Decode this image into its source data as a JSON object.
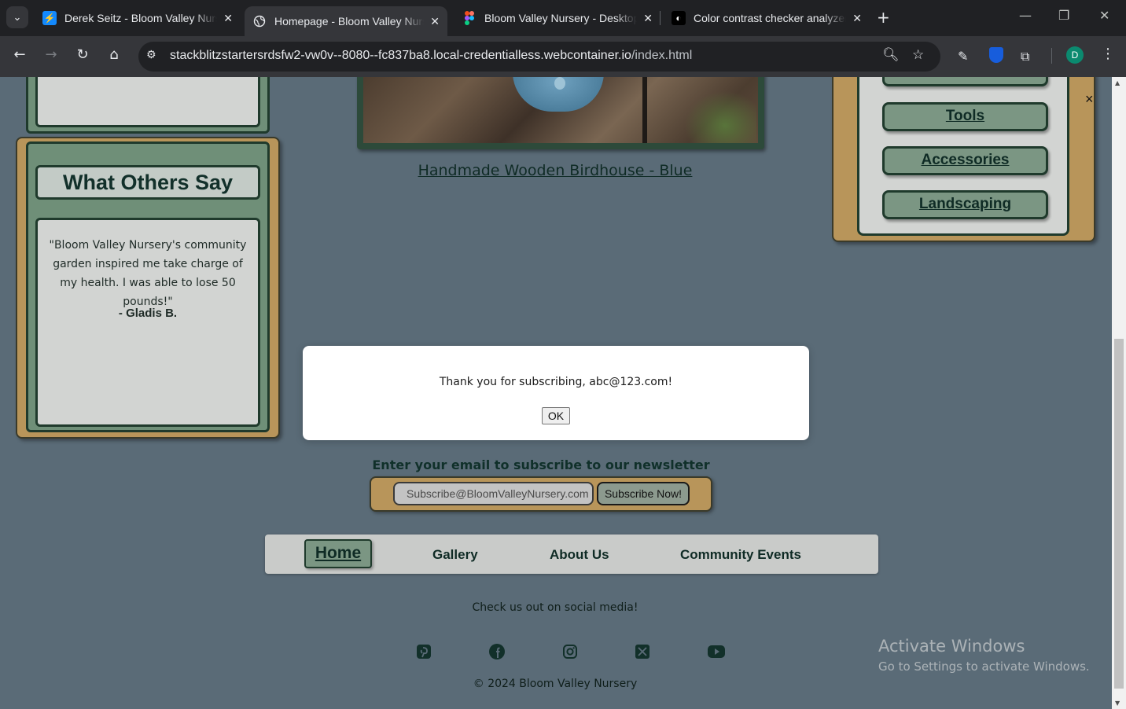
{
  "browser": {
    "tabs": [
      {
        "title": "Derek Seitz - Bloom Valley Nursery",
        "active": false,
        "favicon": "stackblitz-icon"
      },
      {
        "title": "Homepage - Bloom Valley Nursery",
        "active": true,
        "favicon": "globe-icon"
      },
      {
        "title": "Bloom Valley Nursery - Desktop",
        "active": false,
        "favicon": "figma-icon"
      },
      {
        "title": "Color contrast checker analyzer",
        "active": false,
        "favicon": "contrast-icon"
      }
    ],
    "url_host": "stackblitzstartersrdsfw2-vw0v--8080--fc837ba8.local-credentialless.webcontainer.io",
    "url_path": "/index.html",
    "profile_initial": "D"
  },
  "testimonials": {
    "heading": "What Others Say",
    "quote": "\"Bloom Valley Nursery's community garden inspired me take charge of my health. I was able to lose 50 pounds!\"",
    "author": "- Gladis B."
  },
  "product": {
    "link_text": "Handmade Wooden Birdhouse - Blue"
  },
  "categories": {
    "items": [
      "Tools",
      "Accessories",
      "Landscaping"
    ],
    "close_label": "×"
  },
  "dialog": {
    "message": "Thank you for subscribing, abc@123.com!",
    "ok_label": "OK"
  },
  "newsletter": {
    "label": "Enter your email to subscribe to our newsletter",
    "placeholder": "Subscribe@BloomValleyNursery.com",
    "button_label": "Subscribe Now!"
  },
  "footer": {
    "nav": [
      "Home",
      "Gallery",
      "About Us",
      "Community Events"
    ],
    "active_nav": "Home",
    "social_label": "Check us out on social media!",
    "social_icons": [
      "pinterest-icon",
      "facebook-icon",
      "instagram-icon",
      "x-icon",
      "youtube-icon"
    ],
    "copyright": "© 2024 Bloom Valley Nursery"
  },
  "watermark": {
    "title": "Activate Windows",
    "subtitle": "Go to Settings to activate Windows."
  },
  "colors": {
    "page_bg": "#5a6b77",
    "accent_green": "#7b9683",
    "accent_tan": "#b8955a",
    "dark_green": "#1f3a2c"
  }
}
